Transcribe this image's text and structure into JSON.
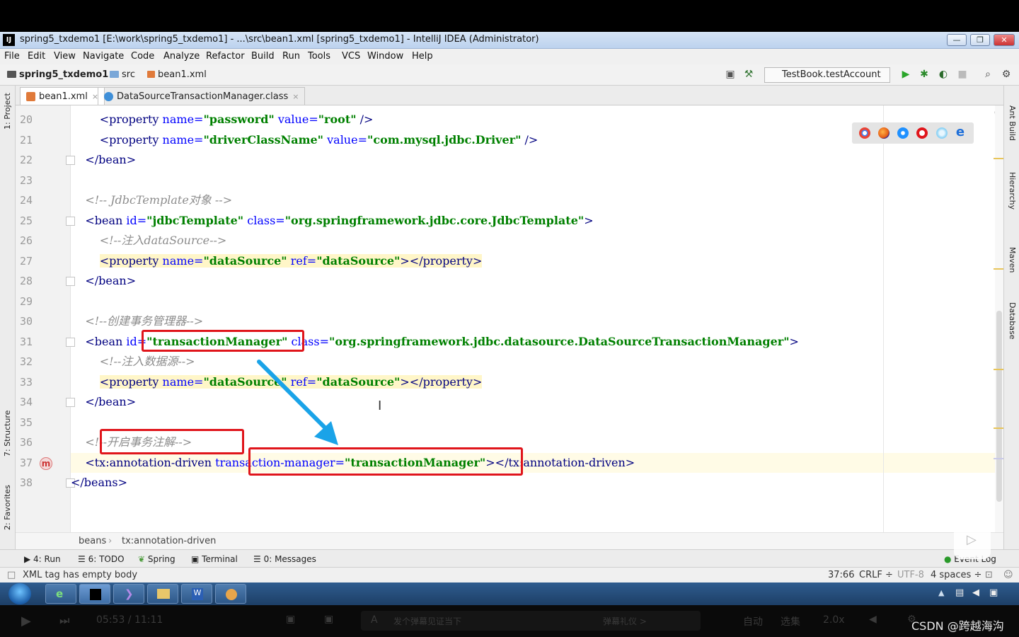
{
  "window": {
    "title": "spring5_txdemo1 [E:\\work\\spring5_txdemo1] - ...\\src\\bean1.xml [spring5_txdemo1] - IntelliJ IDEA (Administrator)",
    "app_icon": "IJ",
    "minimize": "—",
    "restore": "❐",
    "close": "✕"
  },
  "menu": [
    "File",
    "Edit",
    "View",
    "Navigate",
    "Code",
    "Analyze",
    "Refactor",
    "Build",
    "Run",
    "Tools",
    "VCS",
    "Window",
    "Help"
  ],
  "navbar": {
    "project": "spring5_txdemo1",
    "folder": "src",
    "file": "bean1.xml",
    "run_config": "TestBook.testAccount"
  },
  "tabs": [
    {
      "label": "bean1.xml",
      "close": "×",
      "icon_color": "#e07a3a"
    },
    {
      "label": "DataSourceTransactionManager.class",
      "close": "×",
      "icon_color": "#3f8fd8"
    }
  ],
  "left_tools": [
    "1: Project",
    "7: Structure",
    "2: Favorites"
  ],
  "right_tools": [
    "Ant Build",
    "Hierarchy",
    "Maven",
    "Database"
  ],
  "editor": {
    "lines": [
      {
        "n": "20",
        "parts": [
          [
            "",
            "        "
          ],
          [
            "t",
            "<property"
          ],
          [
            "",
            " "
          ],
          [
            "a",
            "name="
          ],
          [
            "s",
            "\"password\""
          ],
          [
            "",
            " "
          ],
          [
            "a",
            "value="
          ],
          [
            "s",
            "\"root\""
          ],
          [
            "t",
            " />"
          ]
        ]
      },
      {
        "n": "21",
        "parts": [
          [
            "",
            "        "
          ],
          [
            "t",
            "<property"
          ],
          [
            "",
            " "
          ],
          [
            "a",
            "name="
          ],
          [
            "s",
            "\"driverClassName\""
          ],
          [
            "",
            " "
          ],
          [
            "a",
            "value="
          ],
          [
            "s",
            "\"com.mysql.jdbc.Driver\""
          ],
          [
            "t",
            " />"
          ]
        ]
      },
      {
        "n": "22",
        "parts": [
          [
            "",
            "    "
          ],
          [
            "t",
            "</bean>"
          ]
        ]
      },
      {
        "n": "23",
        "parts": [
          [
            "",
            ""
          ]
        ]
      },
      {
        "n": "24",
        "parts": [
          [
            "",
            "    "
          ],
          [
            "c",
            "<!-- JdbcTemplate对象 -->"
          ]
        ]
      },
      {
        "n": "25",
        "parts": [
          [
            "",
            "    "
          ],
          [
            "t",
            "<bean"
          ],
          [
            "",
            " "
          ],
          [
            "a",
            "id="
          ],
          [
            "s",
            "\"jdbcTemplate\""
          ],
          [
            "",
            " "
          ],
          [
            "a",
            "class="
          ],
          [
            "s",
            "\"org.springframework.jdbc.core.JdbcTemplate\""
          ],
          [
            "t",
            ">"
          ]
        ]
      },
      {
        "n": "26",
        "parts": [
          [
            "",
            "        "
          ],
          [
            "c",
            "<!--注入dataSource-->"
          ]
        ]
      },
      {
        "n": "27",
        "parts": [
          [
            "",
            "        "
          ],
          [
            "th",
            "<property"
          ],
          [
            "h",
            " "
          ],
          [
            "ah",
            "name="
          ],
          [
            "sh",
            "\"dataSource\""
          ],
          [
            "h",
            " "
          ],
          [
            "ah",
            "ref="
          ],
          [
            "sh",
            "\"dataSource\""
          ],
          [
            "th",
            "></property>"
          ]
        ]
      },
      {
        "n": "28",
        "parts": [
          [
            "",
            "    "
          ],
          [
            "t",
            "</bean>"
          ]
        ]
      },
      {
        "n": "29",
        "parts": [
          [
            "",
            ""
          ]
        ]
      },
      {
        "n": "30",
        "parts": [
          [
            "",
            "    "
          ],
          [
            "c",
            "<!--创建事务管理器-->"
          ]
        ]
      },
      {
        "n": "31",
        "parts": [
          [
            "",
            "    "
          ],
          [
            "t",
            "<bean"
          ],
          [
            "",
            " "
          ],
          [
            "a",
            "id="
          ],
          [
            "s",
            "\"transactionManager\""
          ],
          [
            "",
            " "
          ],
          [
            "a",
            "class="
          ],
          [
            "s",
            "\"org.springframework.jdbc.datasource.DataSourceTransactionManager\""
          ],
          [
            "t",
            ">"
          ]
        ]
      },
      {
        "n": "32",
        "parts": [
          [
            "",
            "        "
          ],
          [
            "c",
            "<!--注入数据源-->"
          ]
        ]
      },
      {
        "n": "33",
        "parts": [
          [
            "",
            "        "
          ],
          [
            "th",
            "<property"
          ],
          [
            "h",
            " "
          ],
          [
            "ah",
            "name="
          ],
          [
            "sh",
            "\"dataSource\""
          ],
          [
            "h",
            " "
          ],
          [
            "ah",
            "ref="
          ],
          [
            "sh",
            "\"dataSource\""
          ],
          [
            "th",
            "></property>"
          ]
        ]
      },
      {
        "n": "34",
        "parts": [
          [
            "",
            "    "
          ],
          [
            "t",
            "</bean>"
          ]
        ]
      },
      {
        "n": "35",
        "parts": [
          [
            "",
            ""
          ]
        ]
      },
      {
        "n": "36",
        "parts": [
          [
            "",
            "    "
          ],
          [
            "c",
            "<!--开启事务注解-->"
          ]
        ]
      },
      {
        "n": "37",
        "parts": [
          [
            "",
            "    "
          ],
          [
            "t",
            "<tx:annotation-driven"
          ],
          [
            "",
            " "
          ],
          [
            "a",
            "transaction-manager="
          ],
          [
            "s",
            "\"transactionManager\""
          ],
          [
            "t",
            "></tx:annotation-driven>"
          ]
        ]
      },
      {
        "n": "38",
        "parts": [
          [
            "t",
            "</beans>"
          ]
        ]
      }
    ],
    "gutter_marker": "m"
  },
  "breadcrumb": [
    "beans",
    "tx:annotation-driven"
  ],
  "tool_windows": [
    "4: Run",
    "6: TODO",
    "Spring",
    "Terminal",
    "0: Messages",
    "Event Log"
  ],
  "status": {
    "message": "XML tag has empty body",
    "position": "37:66",
    "line_sep": "CRLF ÷",
    "encoding": "UTF-8",
    "indent": "4 spaces ÷"
  },
  "video": {
    "time": "05:53 / 11:11",
    "danmaku_placeholder": "发个弹幕见证当下",
    "danmaku_etiquette": "弹幕礼仪 >",
    "auto": "自动",
    "episodes": "选集",
    "speed": "2.0x",
    "watermark": "CSDN @跨越海沟"
  },
  "colors": {
    "accent_red": "#e0151b",
    "arrow_blue": "#1aa3e8",
    "xml_tag": "#000080",
    "xml_attr": "#0000ff",
    "xml_string": "#008000",
    "comment": "#8c8c8c"
  }
}
